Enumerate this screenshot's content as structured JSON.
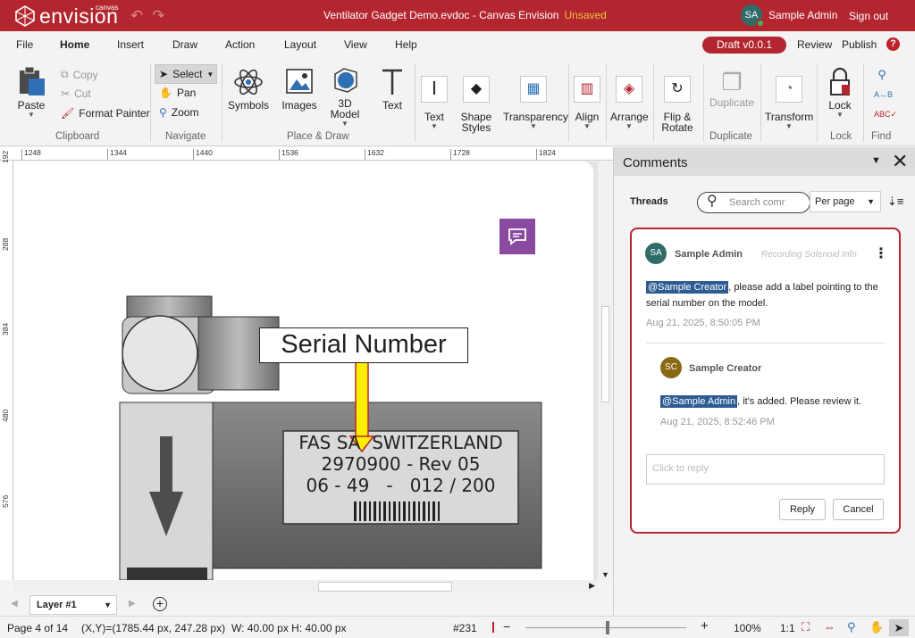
{
  "app": {
    "brand": "envision",
    "brand_sup": "canvas",
    "document_title": "Ventilator Gadget Demo.evdoc - Canvas Envision",
    "unsaved_label": "Unsaved",
    "user_initials": "SA",
    "user_name": "Sample Admin",
    "signout_label": "Sign out"
  },
  "menu": {
    "file": "File",
    "home": "Home",
    "insert": "Insert",
    "draw": "Draw",
    "action": "Action",
    "layout": "Layout",
    "view": "View",
    "help": "Help",
    "draft": "Draft v0.0.1",
    "review": "Review",
    "publish": "Publish",
    "help_icon": "?"
  },
  "ribbon": {
    "paste": "Paste",
    "copy": "Copy",
    "cut": "Cut",
    "format_painter": "Format Painter",
    "clipboard_group": "Clipboard",
    "select": "Select",
    "pan": "Pan",
    "zoom": "Zoom",
    "navigate_group": "Navigate",
    "symbols": "Symbols",
    "images": "Images",
    "model_3d_1": "3D",
    "model_3d_2": "Model",
    "text_tool": "Text",
    "place_draw_group": "Place & Draw",
    "text_style": "Text",
    "shape_styles_1": "Shape",
    "shape_styles_2": "Styles",
    "transparency": "Transparency",
    "align": "Align",
    "arrange": "Arrange",
    "flip_rotate_1": "Flip &",
    "flip_rotate_2": "Rotate",
    "duplicate": "Duplicate",
    "duplicate_group": "Duplicate",
    "transform": "Transform",
    "lock": "Lock",
    "lock_group": "Lock",
    "find_group": "Find"
  },
  "rulers": {
    "h": [
      "1248",
      "1344",
      "1440",
      "1536",
      "1632",
      "1728",
      "1824"
    ],
    "v": [
      "192",
      "288",
      "384",
      "480",
      "576"
    ]
  },
  "canvas": {
    "callout_label": "Serial Number",
    "plate_line1": "FAS SA  SWITZERLAND",
    "plate_line2": "2970900 - Rev 05",
    "plate_line3": "06 - 49   -   012 / 200"
  },
  "layer": {
    "name": "Layer #1"
  },
  "status": {
    "page": "Page 4 of 14",
    "coords": "(X,Y)=(1785.44 px, 247.28 px)",
    "size": "W: 40.00 px H: 40.00 px",
    "object_id": "#231",
    "zoom": "100%",
    "ratio": "1:1",
    "zoom_fraction": 0.51
  },
  "comments": {
    "title": "Comments",
    "threads_label": "Threads",
    "search_placeholder": "Search comr",
    "per_page": "Per page",
    "thread": {
      "author_initials": "SA",
      "author": "Sample Admin",
      "context": "Recording Solenoid Info",
      "mention": "@Sample Creator",
      "text_line1": ", please add a label pointing to the",
      "text_line2": "serial number on the model.",
      "time": "Aug 21, 2025, 8:50:05 PM",
      "reply": {
        "author_initials": "SC",
        "author": "Sample Creator",
        "mention": "@Sample Admin",
        "text": ", it's added. Please review it.",
        "time": "Aug 21, 2025, 8:52:46 PM"
      },
      "reply_placeholder": "Click to reply",
      "reply_button": "Reply",
      "cancel_button": "Cancel"
    }
  },
  "colors": {
    "brand_red": "#b3262f",
    "mention_blue": "#2d5c93",
    "comment_marker": "#8a4aa0"
  }
}
